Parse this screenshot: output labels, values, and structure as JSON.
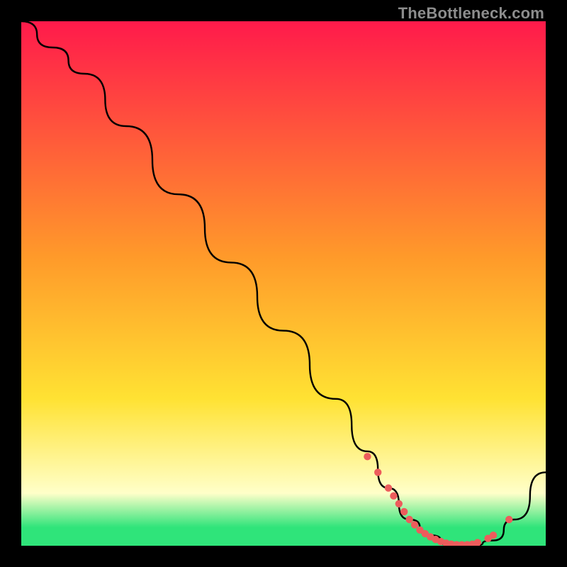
{
  "watermark": "TheBottleneck.com",
  "colors": {
    "line": "#000000",
    "dot": "#ed5c5c",
    "grad_top": "#ff1a4b",
    "grad_mid1": "#ff9a2a",
    "grad_mid2": "#ffe233",
    "grad_cream": "#ffffc9",
    "grad_green": "#2fe47a",
    "background": "#000000"
  },
  "chart_data": {
    "type": "line",
    "title": "",
    "xlabel": "",
    "ylabel": "",
    "xlim": [
      0,
      100
    ],
    "ylim": [
      0,
      100
    ],
    "series": [
      {
        "name": "bottleneck-curve",
        "x": [
          0,
          6,
          12,
          20,
          30,
          40,
          50,
          60,
          66,
          70,
          74,
          78,
          82,
          86,
          90,
          94,
          100
        ],
        "y": [
          100,
          95,
          90,
          80,
          67,
          54,
          41,
          28,
          18,
          11,
          5,
          2,
          0,
          0,
          1,
          5,
          14
        ]
      }
    ],
    "points": {
      "name": "highlight-dots",
      "x": [
        66,
        68,
        70,
        71,
        72,
        73,
        74,
        75,
        76,
        77,
        78,
        79,
        80,
        81,
        82,
        83,
        84,
        85,
        86,
        87,
        89,
        90,
        93
      ],
      "y": [
        17,
        14,
        11,
        9.5,
        8,
        6.5,
        5,
        4,
        3,
        2.3,
        1.7,
        1.2,
        0.8,
        0.5,
        0.3,
        0.2,
        0.2,
        0.2,
        0.3,
        0.6,
        1.4,
        2,
        5
      ]
    },
    "gradient_stops": [
      {
        "offset": 0.0,
        "key": "grad_top"
      },
      {
        "offset": 0.45,
        "key": "grad_mid1"
      },
      {
        "offset": 0.72,
        "key": "grad_mid2"
      },
      {
        "offset": 0.9,
        "key": "grad_cream"
      },
      {
        "offset": 0.965,
        "key": "grad_green"
      },
      {
        "offset": 1.0,
        "key": "grad_green"
      }
    ]
  }
}
